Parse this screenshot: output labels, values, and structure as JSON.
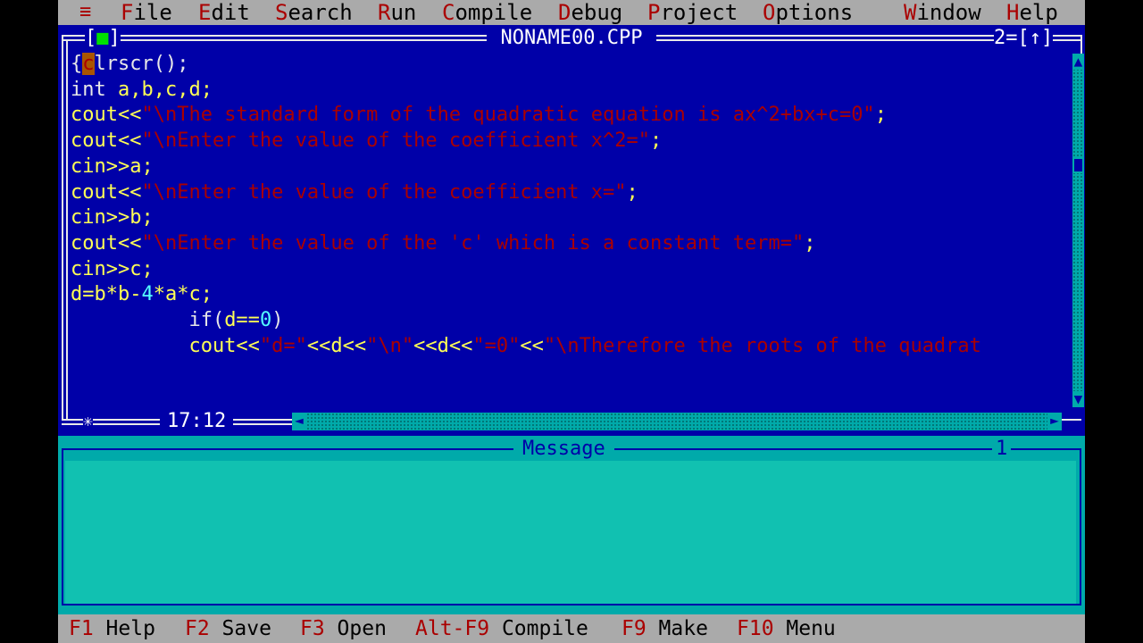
{
  "menu": {
    "system": "≡",
    "items": [
      {
        "hot": "F",
        "rest": "ile"
      },
      {
        "hot": "E",
        "rest": "dit"
      },
      {
        "hot": "S",
        "rest": "earch"
      },
      {
        "hot": "R",
        "rest": "un"
      },
      {
        "hot": "C",
        "rest": "ompile"
      },
      {
        "hot": "D",
        "rest": "ebug"
      },
      {
        "hot": "P",
        "rest": "roject"
      },
      {
        "hot": "O",
        "rest": "ptions"
      },
      {
        "hot": "W",
        "rest": "indow"
      },
      {
        "hot": "H",
        "rest": "elp"
      }
    ]
  },
  "editor": {
    "close_box": "■",
    "title": "NONAME00.CPP",
    "window_number": "2=[↑]",
    "position": "17:12",
    "lines": [
      [
        {
          "c": "w",
          "t": "{"
        },
        {
          "c": "cursor",
          "t": "c"
        },
        {
          "c": "w",
          "t": "lrscr();"
        }
      ],
      [
        {
          "c": "w",
          "t": "int "
        },
        {
          "c": "y",
          "t": "a,b,c,d;"
        }
      ],
      [
        {
          "c": "y",
          "t": "cout<<"
        },
        {
          "c": "s",
          "t": "\"\\nThe standard form of the quadratic equation is ax^2+bx+c=0\""
        },
        {
          "c": "y",
          "t": ";"
        }
      ],
      [
        {
          "c": "y",
          "t": "cout<<"
        },
        {
          "c": "s",
          "t": "\"\\nEnter the value of the coefficient x^2=\""
        },
        {
          "c": "y",
          "t": ";"
        }
      ],
      [
        {
          "c": "y",
          "t": "cin>>a;"
        }
      ],
      [
        {
          "c": "y",
          "t": "cout<<"
        },
        {
          "c": "s",
          "t": "\"\\nEnter the value of the coefficient x=\""
        },
        {
          "c": "y",
          "t": ";"
        }
      ],
      [
        {
          "c": "y",
          "t": "cin>>b;"
        }
      ],
      [
        {
          "c": "y",
          "t": "cout<<"
        },
        {
          "c": "s",
          "t": "\"\\nEnter the value of the 'c' which is a constant term=\""
        },
        {
          "c": "y",
          "t": ";"
        }
      ],
      [
        {
          "c": "y",
          "t": "cin>>c;"
        }
      ],
      [
        {
          "c": "y",
          "t": "d=b*b-"
        },
        {
          "c": "c",
          "t": "4"
        },
        {
          "c": "y",
          "t": "*a*c;"
        }
      ],
      [
        {
          "c": "w",
          "t": "          if("
        },
        {
          "c": "y",
          "t": "d=="
        },
        {
          "c": "c",
          "t": "0"
        },
        {
          "c": "w",
          "t": ")"
        }
      ],
      [
        {
          "c": "y",
          "t": "          cout<<"
        },
        {
          "c": "s",
          "t": "\"d=\""
        },
        {
          "c": "y",
          "t": "<<d<<"
        },
        {
          "c": "s",
          "t": "\"\\n\""
        },
        {
          "c": "y",
          "t": "<<d<<"
        },
        {
          "c": "s",
          "t": "\"=0\""
        },
        {
          "c": "y",
          "t": "<<"
        },
        {
          "c": "s",
          "t": "\"\\nTherefore the roots of the quadrat"
        }
      ]
    ]
  },
  "message": {
    "title": "Message",
    "number": "1"
  },
  "status": {
    "keys": [
      {
        "key": "F1",
        "label": " Help"
      },
      {
        "key": "F2",
        "label": " Save"
      },
      {
        "key": "F3",
        "label": " Open"
      },
      {
        "key": "Alt-F9",
        "label": " Compile"
      },
      {
        "key": "F9",
        "label": " Make"
      },
      {
        "key": "F10",
        "label": " Menu"
      }
    ]
  },
  "colors": {
    "editor_bg": "#0000a8",
    "menu_bg": "#aaaaaa",
    "hotkey": "#aa0000",
    "message_bg": "#00aaaa",
    "string": "#aa0000",
    "identifier": "#ffff55",
    "number": "#55ffff"
  }
}
